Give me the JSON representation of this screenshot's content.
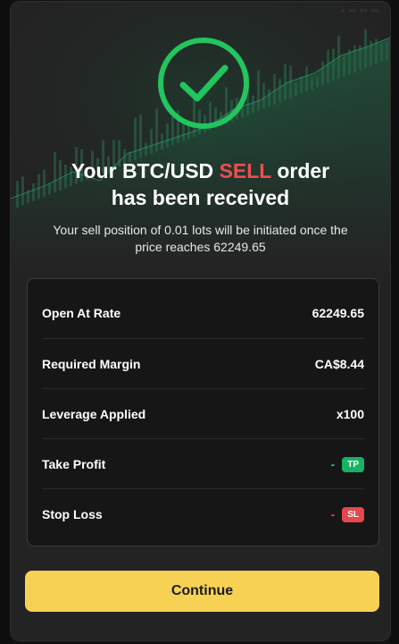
{
  "colors": {
    "accent_green": "#22c55e",
    "sell_red": "#ef4d4d",
    "button_yellow": "#f7d154",
    "modal_bg": "#232323"
  },
  "icons": {
    "success": "check-circle-icon"
  },
  "headline": {
    "part1": "Your BTC/USD ",
    "side": "SELL",
    "part2": " order",
    "line2": "has been received"
  },
  "subtext": "Your sell position of 0.01 lots will be initiated once the price reaches 62249.65",
  "details": [
    {
      "label": "Open At Rate",
      "value": "62249.65"
    },
    {
      "label": "Required Margin",
      "value": "CA$8.44"
    },
    {
      "label": "Leverage Applied",
      "value": "x100"
    },
    {
      "label": "Take Profit",
      "value": "-",
      "tag": "TP"
    },
    {
      "label": "Stop Loss",
      "value": "-",
      "tag": "SL"
    }
  ],
  "button": {
    "label": "Continue"
  }
}
